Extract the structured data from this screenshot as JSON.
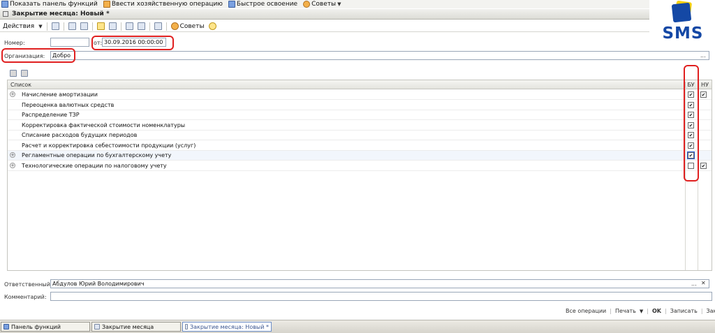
{
  "toolbar": {
    "show_panel": "Показать панель функций",
    "enter_operation": "Ввести хозяйственную операцию",
    "quick_start": "Быстрое освоение",
    "tips": "Советы"
  },
  "window": {
    "title": "Закрытие месяца: Новый *"
  },
  "actions": {
    "menu": "Действия",
    "tips": "Советы"
  },
  "logo": {
    "text": "SMS"
  },
  "form": {
    "number_label": "Номер:",
    "number_value": "",
    "date_label": "от:",
    "date_value": "30.09.2016 00:00:00",
    "org_label": "Организация:",
    "org_value": "Добро",
    "org_more": "..."
  },
  "table": {
    "col_list": "Список",
    "col_bu": "БУ",
    "col_nu": "НУ",
    "rows": [
      {
        "text": "Начисление амортизации",
        "expandable": true,
        "bu": true,
        "nu": true
      },
      {
        "text": "Переоценка валютных средств",
        "expandable": false,
        "bu": true,
        "nu": false
      },
      {
        "text": "Распределение ТЗР",
        "expandable": false,
        "bu": true,
        "nu": false
      },
      {
        "text": "Корректировка фактической стоимости номенклатуры",
        "expandable": false,
        "bu": true,
        "nu": false
      },
      {
        "text": "Списание расходов будущих периодов",
        "expandable": false,
        "bu": true,
        "nu": false
      },
      {
        "text": "Расчет и корректировка себестоимости продукции (услуг)",
        "expandable": false,
        "bu": true,
        "nu": false
      },
      {
        "text": "Регламентные операции по бухгалтерскому учету",
        "expandable": true,
        "bu": true,
        "nu": false,
        "selected": true
      },
      {
        "text": "Технологические операции по налоговому учету",
        "expandable": true,
        "bu": false,
        "nu": true
      }
    ]
  },
  "footer": {
    "resp_label": "Ответственный:",
    "resp_value": "Абдулов Юрий Володимирович",
    "comment_label": "Комментарий:",
    "comment_value": "",
    "all_ops": "Все операции",
    "print": "Печать",
    "ok": "OK",
    "save": "Записать",
    "close": "Закрыть"
  },
  "taskbar": {
    "items": [
      {
        "label": "Панель функций"
      },
      {
        "label": "Закрытие месяца"
      },
      {
        "label": "Закрытие месяца: Новый *"
      }
    ]
  }
}
